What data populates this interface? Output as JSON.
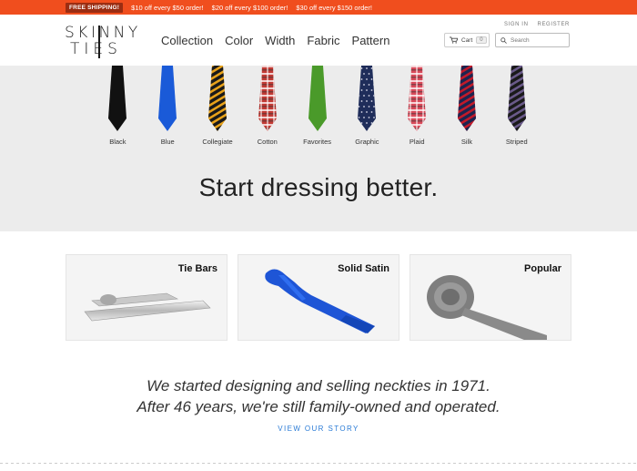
{
  "promo": {
    "badge": "FREE SHIPPING!",
    "offers": [
      "$10 off every $50 order!",
      "$20 off every $100 order!",
      "$30 off every $150 order!"
    ]
  },
  "logo": {
    "line1": "SKINNY",
    "line2": "TIES"
  },
  "nav": [
    "Collection",
    "Color",
    "Width",
    "Fabric",
    "Pattern"
  ],
  "auth": {
    "sign_in": "SIGN IN",
    "register": "REGISTER"
  },
  "cart": {
    "label": "Cart",
    "count": "0"
  },
  "search": {
    "placeholder": "Search"
  },
  "ties": [
    {
      "label": "Black",
      "color": "#111111",
      "pattern": "solid"
    },
    {
      "label": "Blue",
      "color": "#1a5ad8",
      "pattern": "solid"
    },
    {
      "label": "Collegiate",
      "color": "#e8a21a",
      "pattern": "stripe-dark"
    },
    {
      "label": "Cotton",
      "color": "#c23a34",
      "pattern": "plaid"
    },
    {
      "label": "Favorites",
      "color": "#4a9a2a",
      "pattern": "solid"
    },
    {
      "label": "Graphic",
      "color": "#1f2d5a",
      "pattern": "dots"
    },
    {
      "label": "Plaid",
      "color": "#d94a5a",
      "pattern": "plaid"
    },
    {
      "label": "Silk",
      "color": "#c21a2a",
      "pattern": "stripe-navy"
    },
    {
      "label": "Striped",
      "color": "#6a5a8a",
      "pattern": "stripe-dark"
    }
  ],
  "hero": {
    "tagline": "Start dressing better."
  },
  "cards": [
    {
      "title": "Tie Bars"
    },
    {
      "title": "Solid Satin"
    },
    {
      "title": "Popular"
    }
  ],
  "story": {
    "line1": "We started designing and selling neckties in 1971.",
    "line2": "After 46 years, we're still family-owned and operated.",
    "cta": "VIEW OUR STORY"
  },
  "colors": {
    "promo": "#f04e1e",
    "link": "#2a7bd6",
    "hero_bg": "#ececec"
  }
}
